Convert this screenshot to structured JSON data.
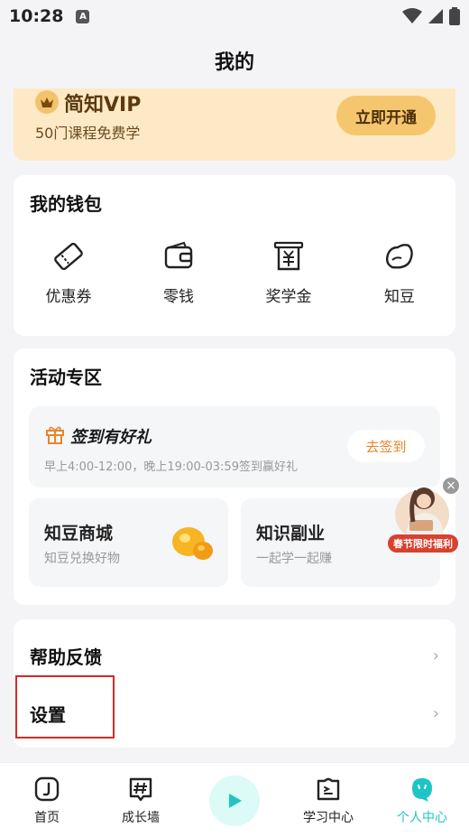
{
  "status": {
    "time": "10:28",
    "notif_letter": "A"
  },
  "header": {
    "title": "我的"
  },
  "vip": {
    "title": "简知VIP",
    "subtitle": "50门课程免费学",
    "button": "立即开通"
  },
  "wallet": {
    "title": "我的钱包",
    "items": [
      {
        "label": "优惠券",
        "icon": "coupon-icon"
      },
      {
        "label": "零钱",
        "icon": "wallet-icon"
      },
      {
        "label": "奖学金",
        "icon": "scholarship-icon"
      },
      {
        "label": "知豆",
        "icon": "bean-icon"
      }
    ]
  },
  "activity": {
    "title": "活动专区",
    "checkin": {
      "title": "签到有好礼",
      "desc": "早上4:00-12:00，晚上19:00-03:59签到赢好礼",
      "button": "去签到"
    },
    "cards": [
      {
        "title": "知豆商城",
        "subtitle": "知豆兑换好物"
      },
      {
        "title": "知识副业",
        "subtitle": "一起学一起赚"
      }
    ],
    "promo": {
      "label": "春节限时福利"
    }
  },
  "menu": {
    "items": [
      {
        "label": "帮助反馈"
      },
      {
        "label": "设置"
      }
    ]
  },
  "nav": {
    "items": [
      {
        "label": "首页"
      },
      {
        "label": "成长墙"
      },
      {
        "label": "学习中心"
      },
      {
        "label": "个人中心"
      }
    ],
    "active_color": "#1fc4c4"
  }
}
